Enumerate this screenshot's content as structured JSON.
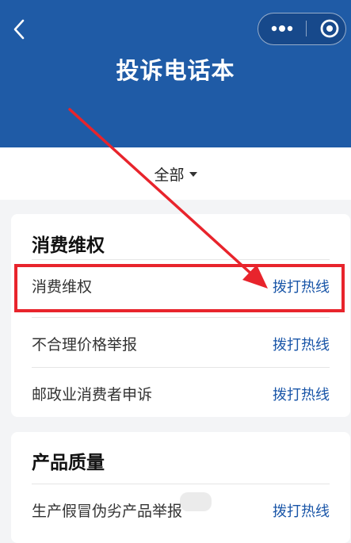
{
  "header": {
    "title": "投诉电话本",
    "back_icon": "chevron-left-icon",
    "more_icon": "more-dots-icon",
    "close_icon": "target-circle-icon",
    "background_color": "#1f5ba6"
  },
  "filter": {
    "label": "全部",
    "icon": "caret-down-icon"
  },
  "sections": [
    {
      "title": "消费维权",
      "items": [
        {
          "name": "消费维权",
          "action": "拨打热线"
        },
        {
          "name": "不合理价格举报",
          "action": "拨打热线"
        },
        {
          "name": "邮政业消费者申诉",
          "action": "拨打热线"
        }
      ]
    },
    {
      "title": "产品质量",
      "items": [
        {
          "name": "生产假冒伪劣产品举报",
          "action": "拨打热线"
        }
      ]
    }
  ],
  "annotation": {
    "color": "#e8242c"
  },
  "colors": {
    "link": "#1a56a8",
    "page_background": "#f3f4f6"
  }
}
